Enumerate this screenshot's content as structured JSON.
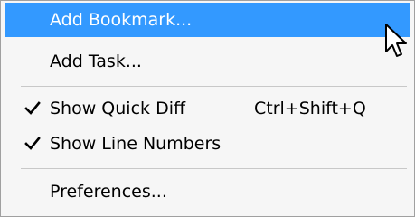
{
  "menu": {
    "items": [
      {
        "label": "Add Bookmark...",
        "highlighted": true,
        "checked": false,
        "shortcut": ""
      },
      {
        "label": "Add Task...",
        "highlighted": false,
        "checked": false,
        "shortcut": ""
      },
      {
        "label": "Show Quick Diff",
        "highlighted": false,
        "checked": true,
        "shortcut": "Ctrl+Shift+Q"
      },
      {
        "label": "Show Line Numbers",
        "highlighted": false,
        "checked": true,
        "shortcut": ""
      },
      {
        "label": "Preferences...",
        "highlighted": false,
        "checked": false,
        "shortcut": ""
      }
    ]
  },
  "icons": {
    "check": "check-icon",
    "cursor": "mouse-pointer-icon"
  },
  "colors": {
    "highlight": "#3399ff",
    "highlight_text": "#ffffff",
    "background": "#f6f6f6",
    "text": "#000000"
  }
}
